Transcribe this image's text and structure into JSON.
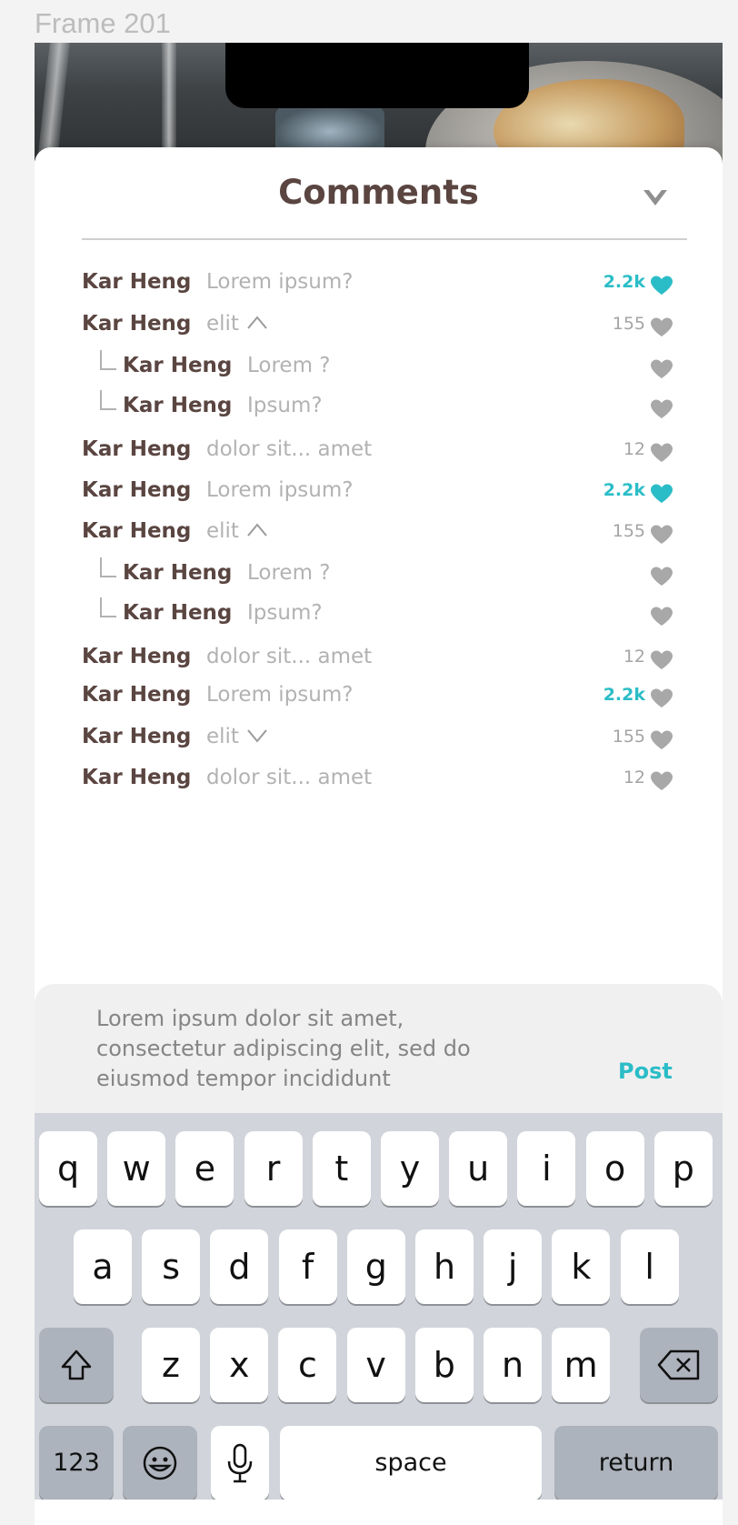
{
  "frame_label": "Frame 201",
  "colors": {
    "accent": "#2bbdc7",
    "name": "#5a4541",
    "muted": "#b2b2b2",
    "heart_gray": "#a8a8a8"
  },
  "sheet": {
    "title": "Comments",
    "collapse_icon": "chevron-down-icon"
  },
  "comments": [
    {
      "author": "Kar Heng",
      "text": "Lorem ipsum?",
      "likes": "2.2k",
      "liked": true,
      "reply": false
    },
    {
      "author": "Kar Heng",
      "text": "elit",
      "toggle": "chevron-up",
      "likes": "155",
      "liked": false,
      "reply": false
    },
    {
      "author": "Kar Heng",
      "text": "Lorem ?",
      "likes": "",
      "liked": false,
      "reply": true
    },
    {
      "author": "Kar Heng",
      "text": "Ipsum?",
      "likes": "",
      "liked": false,
      "reply": true
    },
    {
      "author": "Kar Heng",
      "text": "dolor sit... amet",
      "likes": "12",
      "liked": false,
      "reply": false
    },
    {
      "author": "Kar Heng",
      "text": "Lorem ipsum?",
      "likes": "2.2k",
      "liked": true,
      "reply": false
    },
    {
      "author": "Kar Heng",
      "text": "elit",
      "toggle": "chevron-up",
      "likes": "155",
      "liked": false,
      "reply": false
    },
    {
      "author": "Kar Heng",
      "text": "Lorem ?",
      "likes": "",
      "liked": false,
      "reply": true
    },
    {
      "author": "Kar Heng",
      "text": "Ipsum?",
      "likes": "",
      "liked": false,
      "reply": true
    },
    {
      "author": "Kar Heng",
      "text": "dolor sit... amet",
      "likes": "12",
      "liked": false,
      "reply": false
    },
    {
      "author": "Kar Heng",
      "text": "Lorem ipsum?",
      "likes": "2.2k",
      "liked": false,
      "likes_teal": true,
      "reply": false
    },
    {
      "author": "Kar Heng",
      "text": "elit",
      "toggle": "chevron-down",
      "likes": "155",
      "liked": false,
      "reply": false
    },
    {
      "author": "Kar Heng",
      "text": "dolor sit... amet",
      "likes": "12",
      "liked": false,
      "reply": false
    }
  ],
  "composer": {
    "value": "Lorem ipsum dolor sit amet, consectetur adipiscing elit, sed do eiusmod tempor incididunt",
    "post_label": "Post"
  },
  "keyboard": {
    "row1": [
      "q",
      "w",
      "e",
      "r",
      "t",
      "y",
      "u",
      "i",
      "o",
      "p"
    ],
    "row2": [
      "a",
      "s",
      "d",
      "f",
      "g",
      "h",
      "j",
      "k",
      "l"
    ],
    "row3": [
      "z",
      "x",
      "c",
      "v",
      "b",
      "n",
      "m"
    ],
    "shift_icon": "shift-icon",
    "backspace_icon": "backspace-icon",
    "numbers_label": "123",
    "emoji_icon": "emoji-icon",
    "mic_icon": "microphone-icon",
    "space_label": "space",
    "return_label": "return"
  }
}
